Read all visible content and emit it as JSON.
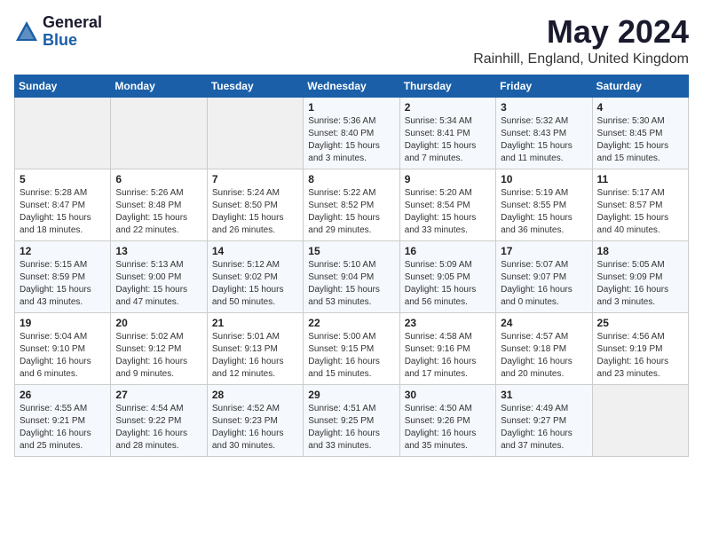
{
  "header": {
    "logo_line1": "General",
    "logo_line2": "Blue",
    "title": "May 2024",
    "subtitle": "Rainhill, England, United Kingdom"
  },
  "weekdays": [
    "Sunday",
    "Monday",
    "Tuesday",
    "Wednesday",
    "Thursday",
    "Friday",
    "Saturday"
  ],
  "weeks": [
    [
      {
        "day": "",
        "info": ""
      },
      {
        "day": "",
        "info": ""
      },
      {
        "day": "",
        "info": ""
      },
      {
        "day": "1",
        "info": "Sunrise: 5:36 AM\nSunset: 8:40 PM\nDaylight: 15 hours\nand 3 minutes."
      },
      {
        "day": "2",
        "info": "Sunrise: 5:34 AM\nSunset: 8:41 PM\nDaylight: 15 hours\nand 7 minutes."
      },
      {
        "day": "3",
        "info": "Sunrise: 5:32 AM\nSunset: 8:43 PM\nDaylight: 15 hours\nand 11 minutes."
      },
      {
        "day": "4",
        "info": "Sunrise: 5:30 AM\nSunset: 8:45 PM\nDaylight: 15 hours\nand 15 minutes."
      }
    ],
    [
      {
        "day": "5",
        "info": "Sunrise: 5:28 AM\nSunset: 8:47 PM\nDaylight: 15 hours\nand 18 minutes."
      },
      {
        "day": "6",
        "info": "Sunrise: 5:26 AM\nSunset: 8:48 PM\nDaylight: 15 hours\nand 22 minutes."
      },
      {
        "day": "7",
        "info": "Sunrise: 5:24 AM\nSunset: 8:50 PM\nDaylight: 15 hours\nand 26 minutes."
      },
      {
        "day": "8",
        "info": "Sunrise: 5:22 AM\nSunset: 8:52 PM\nDaylight: 15 hours\nand 29 minutes."
      },
      {
        "day": "9",
        "info": "Sunrise: 5:20 AM\nSunset: 8:54 PM\nDaylight: 15 hours\nand 33 minutes."
      },
      {
        "day": "10",
        "info": "Sunrise: 5:19 AM\nSunset: 8:55 PM\nDaylight: 15 hours\nand 36 minutes."
      },
      {
        "day": "11",
        "info": "Sunrise: 5:17 AM\nSunset: 8:57 PM\nDaylight: 15 hours\nand 40 minutes."
      }
    ],
    [
      {
        "day": "12",
        "info": "Sunrise: 5:15 AM\nSunset: 8:59 PM\nDaylight: 15 hours\nand 43 minutes."
      },
      {
        "day": "13",
        "info": "Sunrise: 5:13 AM\nSunset: 9:00 PM\nDaylight: 15 hours\nand 47 minutes."
      },
      {
        "day": "14",
        "info": "Sunrise: 5:12 AM\nSunset: 9:02 PM\nDaylight: 15 hours\nand 50 minutes."
      },
      {
        "day": "15",
        "info": "Sunrise: 5:10 AM\nSunset: 9:04 PM\nDaylight: 15 hours\nand 53 minutes."
      },
      {
        "day": "16",
        "info": "Sunrise: 5:09 AM\nSunset: 9:05 PM\nDaylight: 15 hours\nand 56 minutes."
      },
      {
        "day": "17",
        "info": "Sunrise: 5:07 AM\nSunset: 9:07 PM\nDaylight: 16 hours\nand 0 minutes."
      },
      {
        "day": "18",
        "info": "Sunrise: 5:05 AM\nSunset: 9:09 PM\nDaylight: 16 hours\nand 3 minutes."
      }
    ],
    [
      {
        "day": "19",
        "info": "Sunrise: 5:04 AM\nSunset: 9:10 PM\nDaylight: 16 hours\nand 6 minutes."
      },
      {
        "day": "20",
        "info": "Sunrise: 5:02 AM\nSunset: 9:12 PM\nDaylight: 16 hours\nand 9 minutes."
      },
      {
        "day": "21",
        "info": "Sunrise: 5:01 AM\nSunset: 9:13 PM\nDaylight: 16 hours\nand 12 minutes."
      },
      {
        "day": "22",
        "info": "Sunrise: 5:00 AM\nSunset: 9:15 PM\nDaylight: 16 hours\nand 15 minutes."
      },
      {
        "day": "23",
        "info": "Sunrise: 4:58 AM\nSunset: 9:16 PM\nDaylight: 16 hours\nand 17 minutes."
      },
      {
        "day": "24",
        "info": "Sunrise: 4:57 AM\nSunset: 9:18 PM\nDaylight: 16 hours\nand 20 minutes."
      },
      {
        "day": "25",
        "info": "Sunrise: 4:56 AM\nSunset: 9:19 PM\nDaylight: 16 hours\nand 23 minutes."
      }
    ],
    [
      {
        "day": "26",
        "info": "Sunrise: 4:55 AM\nSunset: 9:21 PM\nDaylight: 16 hours\nand 25 minutes."
      },
      {
        "day": "27",
        "info": "Sunrise: 4:54 AM\nSunset: 9:22 PM\nDaylight: 16 hours\nand 28 minutes."
      },
      {
        "day": "28",
        "info": "Sunrise: 4:52 AM\nSunset: 9:23 PM\nDaylight: 16 hours\nand 30 minutes."
      },
      {
        "day": "29",
        "info": "Sunrise: 4:51 AM\nSunset: 9:25 PM\nDaylight: 16 hours\nand 33 minutes."
      },
      {
        "day": "30",
        "info": "Sunrise: 4:50 AM\nSunset: 9:26 PM\nDaylight: 16 hours\nand 35 minutes."
      },
      {
        "day": "31",
        "info": "Sunrise: 4:49 AM\nSunset: 9:27 PM\nDaylight: 16 hours\nand 37 minutes."
      },
      {
        "day": "",
        "info": ""
      }
    ]
  ]
}
